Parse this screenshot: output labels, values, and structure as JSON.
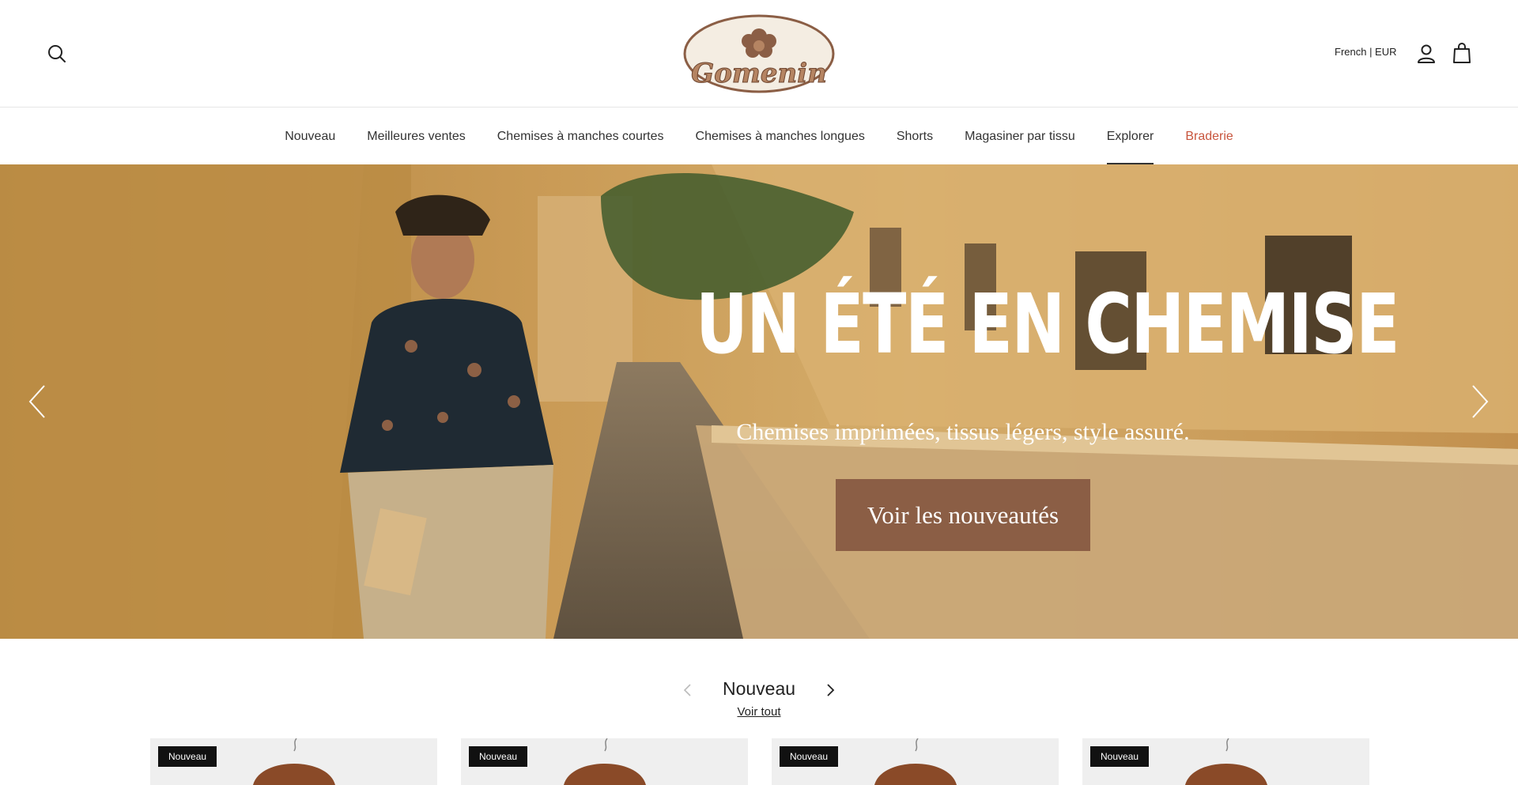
{
  "header": {
    "logo_text": "Gomenin",
    "locale": "French | EUR",
    "icons": {
      "search": "search-icon",
      "account": "user-icon",
      "cart": "shopping-bag-icon"
    }
  },
  "nav": {
    "items": [
      {
        "label": "Nouveau",
        "active": false,
        "sale": false
      },
      {
        "label": "Meilleures ventes",
        "active": false,
        "sale": false
      },
      {
        "label": "Chemises à manches courtes",
        "active": false,
        "sale": false
      },
      {
        "label": "Chemises à manches longues",
        "active": false,
        "sale": false
      },
      {
        "label": "Shorts",
        "active": false,
        "sale": false
      },
      {
        "label": "Magasiner par tissu",
        "active": false,
        "sale": false
      },
      {
        "label": "Explorer",
        "active": true,
        "sale": false
      },
      {
        "label": "Braderie",
        "active": false,
        "sale": true
      }
    ]
  },
  "hero": {
    "title": "UN ÉTÉ EN CHEMISE",
    "subtitle": "Chemises imprimées, tissus légers, style assuré.",
    "cta": "Voir les nouveautés",
    "icons": {
      "prev": "chevron-left-icon",
      "next": "chevron-right-icon"
    }
  },
  "section": {
    "title": "Nouveau",
    "link": "Voir tout",
    "icons": {
      "prev": "chevron-left-icon",
      "next": "chevron-right-icon"
    }
  },
  "products": [
    {
      "badge": "Nouveau"
    },
    {
      "badge": "Nouveau"
    },
    {
      "badge": "Nouveau"
    },
    {
      "badge": "Nouveau"
    }
  ],
  "colors": {
    "accent_cta": "#8b5e45",
    "sale_link": "#c8553d",
    "badge_bg": "#111111"
  }
}
